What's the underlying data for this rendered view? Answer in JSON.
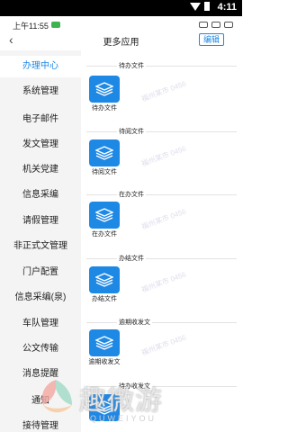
{
  "status_bar": {
    "system_time": "4:11",
    "app_clock": "上午11:55"
  },
  "header": {
    "title": "更多应用",
    "edit_label": "编辑"
  },
  "sidebar": {
    "items": [
      {
        "label": "办理中心",
        "active": true
      },
      {
        "label": "系统管理"
      },
      {
        "label": "电子邮件"
      },
      {
        "label": "发文管理"
      },
      {
        "label": "机关党建"
      },
      {
        "label": "信息采编"
      },
      {
        "label": "请假管理"
      },
      {
        "label": "非正式文管理"
      },
      {
        "label": "门户配置"
      },
      {
        "label": "信息采编(泉)"
      },
      {
        "label": "车队管理"
      },
      {
        "label": "公文传输"
      },
      {
        "label": "消息提醒"
      },
      {
        "label": "通知"
      },
      {
        "label": "接待管理"
      }
    ]
  },
  "content": {
    "sections": [
      {
        "title": "待办文件",
        "app": "待办文件"
      },
      {
        "title": "待阅文件",
        "app": "待阅文件"
      },
      {
        "title": "在办文件",
        "app": "在办文件"
      },
      {
        "title": "办结文件",
        "app": "办结文件"
      },
      {
        "title": "逾期收发文",
        "app": "逾期收发文"
      },
      {
        "title": "待办收发文",
        "app": ""
      }
    ]
  },
  "watermark_text": "福州某市 0456",
  "brand": {
    "name": "趣微游",
    "sub": "QUWEIYOU"
  },
  "colors": {
    "accent": "#1e88e5",
    "sidebar_bg": "#f4f4f4"
  }
}
